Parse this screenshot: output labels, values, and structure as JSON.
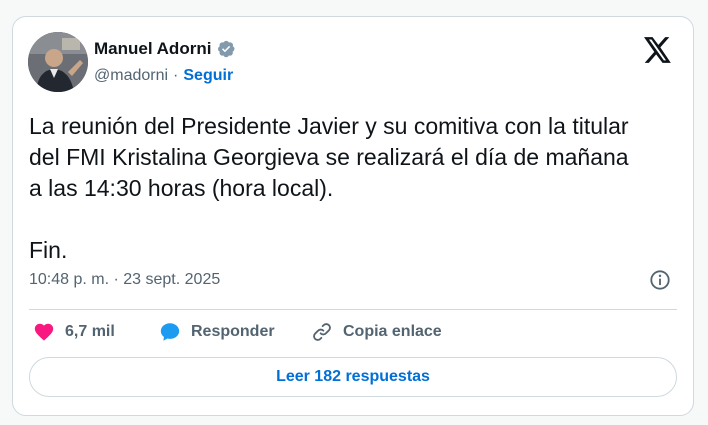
{
  "author": {
    "name": "Manuel Adorni",
    "handle": "@madorni",
    "separator": "·",
    "follow_label": "Seguir"
  },
  "tweet": {
    "text": "La reunión del Presidente Javier y su comitiva con la titular\ndel FMI Kristalina Georgieva se realizará el día de mañana\na las 14:30 horas (hora local).\n\nFin.",
    "timestamp": "10:48 p. m. · 23 sept. 2025"
  },
  "actions": {
    "likes": "6,7 mil",
    "reply_label": "Responder",
    "copy_link_label": "Copia enlace"
  },
  "replies_button_label": "Leer 182 respuestas",
  "icons": {
    "avatar": "avatar-photo",
    "verified": "verified-badge-icon",
    "brand": "x-logo-icon",
    "info": "info-icon",
    "like": "heart-icon",
    "reply": "speech-bubble-icon",
    "link": "link-icon"
  },
  "colors": {
    "like": "#f91880",
    "reply": "#1d9bf0",
    "link_accent": "#006fd6",
    "verified": "#829aab",
    "text_secondary": "#536471"
  }
}
